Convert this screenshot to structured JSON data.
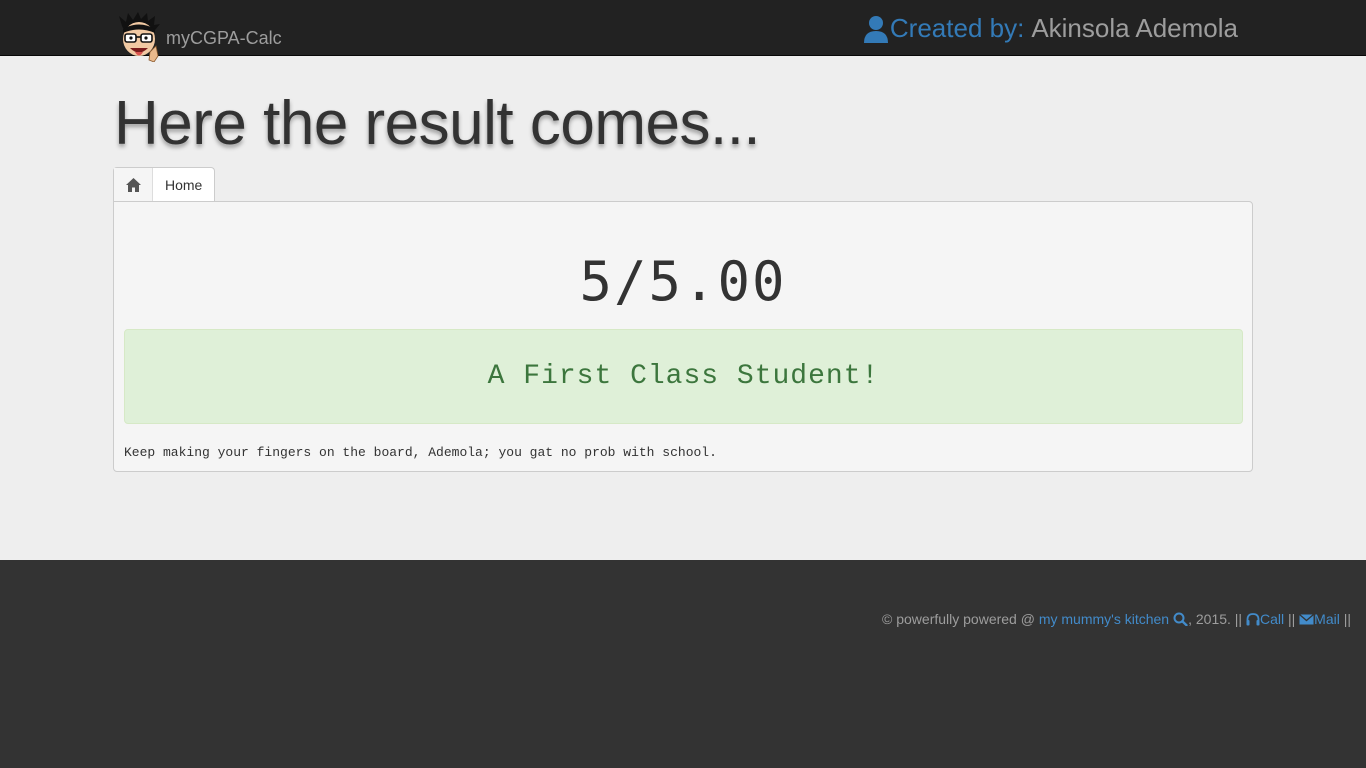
{
  "navbar": {
    "brand": "myCGPA-Calc",
    "creator_label": "Created by:",
    "creator_name": "Akinsola Ademola"
  },
  "page": {
    "title": "Here the result comes..."
  },
  "breadcrumb": {
    "home_label": "Home"
  },
  "result": {
    "score": "5/5.00",
    "classification": "A First Class Student!",
    "note": "Keep making your fingers on the board, Ademola; you gat no prob with school."
  },
  "footer": {
    "prefix": "© powerfully powered @ ",
    "link_text": "my mummy's kitchen",
    "year_text": ", 2015. || ",
    "call_label": "Call",
    "sep": " || ",
    "mail_label": "Mail",
    "suffix": " ||"
  },
  "colors": {
    "navbar_bg": "#222222",
    "link": "#337ab7",
    "success_bg": "#dff0d8",
    "success_text": "#3c763d",
    "footer_bg": "#333333"
  },
  "icons": [
    "avatar-logo",
    "user-icon",
    "home-icon",
    "search-icon",
    "headphones-icon",
    "envelope-icon"
  ]
}
